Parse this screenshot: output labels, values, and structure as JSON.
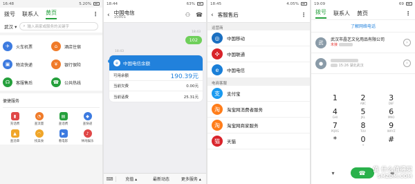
{
  "phone1": {
    "status": {
      "time": "16:48",
      "right": "5.20%"
    },
    "tabs": [
      "拨号",
      "联系人",
      "黄页"
    ],
    "selected_tab": "黄页",
    "location": "武汉",
    "search_placeholder": "输入商家或服务的关键字",
    "services": [
      {
        "label": "火车机票",
        "icon": "train-icon",
        "color": "#3d7be0"
      },
      {
        "label": "酒店住宿",
        "icon": "hotel-icon",
        "color": "#f07b2a"
      },
      {
        "label": "物流快递",
        "icon": "truck-icon",
        "color": "#3d7be0"
      },
      {
        "label": "银行保险",
        "icon": "bank-icon",
        "color": "#f07b2a"
      },
      {
        "label": "客服售后",
        "icon": "headset-icon",
        "color": "#25a03c"
      },
      {
        "label": "公共热线",
        "icon": "phone-icon",
        "color": "#25a03c"
      }
    ],
    "convenience_title": "便捷服务",
    "convenience": [
      {
        "label": "充话费",
        "icon": "recharge-icon",
        "color": "#e04848"
      },
      {
        "label": "查流量",
        "icon": "chart-icon",
        "color": "#f07b2a"
      },
      {
        "label": "查话费",
        "icon": "bill-icon",
        "color": "#25a03c"
      },
      {
        "label": "查快递",
        "icon": "package-icon",
        "color": "#3d7be0"
      },
      {
        "label": "查违章",
        "icon": "car-icon",
        "color": "#f0a62a"
      },
      {
        "label": "找美食",
        "icon": "wifi-icon",
        "color": "#f0a62a"
      },
      {
        "label": "看电影",
        "icon": "movie-icon",
        "color": "#3d7be0"
      },
      {
        "label": "休闲娱乐",
        "icon": "mic-icon",
        "color": "#e04848"
      }
    ]
  },
  "phone2": {
    "status": {
      "time": "18:44",
      "right": "63%"
    },
    "title": "中国电信",
    "number": "10001",
    "time1": "18:43",
    "sent": "102",
    "time2": "18:43",
    "card_title": "中国电信余额",
    "rows": [
      {
        "label": "可用余额",
        "value": "190.39元"
      },
      {
        "label": "当前欠费",
        "value": "0.00元"
      },
      {
        "label": "当前话费",
        "value": "25.31元"
      }
    ],
    "bottom": [
      "充值",
      "最新动态",
      "更多服务"
    ]
  },
  "phone3": {
    "status": {
      "time": "18:45",
      "right": "4.05%"
    },
    "title": "客服售后",
    "section1": "运营商",
    "carriers": [
      {
        "label": "中国移动",
        "icon": "china-mobile-icon",
        "color": "#1a6fc1"
      },
      {
        "label": "中国联通",
        "icon": "china-unicom-icon",
        "color": "#d9232a"
      },
      {
        "label": "中国电信",
        "icon": "china-telecom-icon",
        "color": "#1a7fd8"
      }
    ],
    "section2": "电商客服",
    "ecommerce": [
      {
        "label": "支付宝",
        "icon": "alipay-icon",
        "color": "#1a9bf0"
      },
      {
        "label": "淘宝网消费者服务",
        "icon": "taobao-icon",
        "color": "#ff7d1a"
      },
      {
        "label": "淘宝网商家服务",
        "icon": "taobao-icon",
        "color": "#ff7d1a"
      },
      {
        "label": "天猫",
        "icon": "tmall-icon",
        "color": "#d9232a"
      }
    ]
  },
  "phone4": {
    "status": {
      "time": "19:09",
      "right": "69"
    },
    "tabs": [
      "拨号",
      "联系人",
      "黄页"
    ],
    "selected_tab": "拨号",
    "learn": "了解网络电话",
    "log1": {
      "avatar": "武",
      "name": "武汉市晶艺文化用品有限公司",
      "status": "未接"
    },
    "log2": {
      "time": "15:26",
      "location": "湖北武汉"
    },
    "keys": [
      {
        "n": "1",
        "s": ""
      },
      {
        "n": "2",
        "s": "ABC"
      },
      {
        "n": "3",
        "s": "DEF"
      },
      {
        "n": "4",
        "s": "GHI"
      },
      {
        "n": "5",
        "s": "JKL"
      },
      {
        "n": "6",
        "s": "MNO"
      },
      {
        "n": "7",
        "s": "PQRS"
      },
      {
        "n": "8",
        "s": "TUV"
      },
      {
        "n": "9",
        "s": "WXYZ"
      },
      {
        "n": "*",
        "s": ""
      },
      {
        "n": "0",
        "s": "+"
      },
      {
        "n": "#",
        "s": ""
      }
    ],
    "watermark": "值 什么值得买",
    "watermark_sub": "SMZDM.COM"
  }
}
